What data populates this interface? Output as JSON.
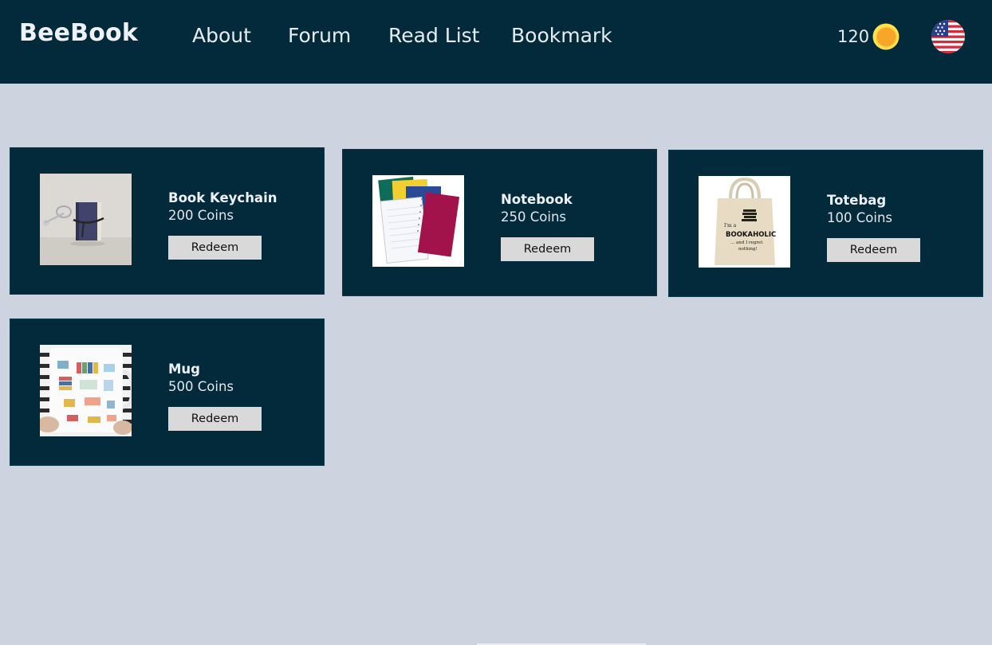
{
  "app": {
    "title": "BeeBook"
  },
  "nav": {
    "about": "About",
    "forum": "Forum",
    "read_list": "Read List",
    "bookmark": "Bookmark"
  },
  "wallet": {
    "coins": "120",
    "coin_icon": "gold-coin-icon",
    "locale_icon": "us-flag-icon"
  },
  "colors": {
    "topbar": "#022a3a",
    "background": "#ced3e0",
    "card": "#022a3a",
    "button": "#d9d9d9",
    "coin": "#f7a62a"
  },
  "rewards": [
    {
      "name": "Book Keychain",
      "price": "200 Coins",
      "button": "Redeem",
      "image": "book-keychain-image"
    },
    {
      "name": "Notebook",
      "price": "250 Coins",
      "button": "Redeem",
      "image": "notebooks-image"
    },
    {
      "name": "Totebag",
      "price": "100 Coins",
      "button": "Redeem",
      "image": "totebag-image",
      "image_text": "I'm a BOOKAHOLIC ... and I regret nothing!"
    },
    {
      "name": "Mug",
      "price": "500 Coins",
      "button": "Redeem",
      "image": "book-mug-image"
    }
  ]
}
